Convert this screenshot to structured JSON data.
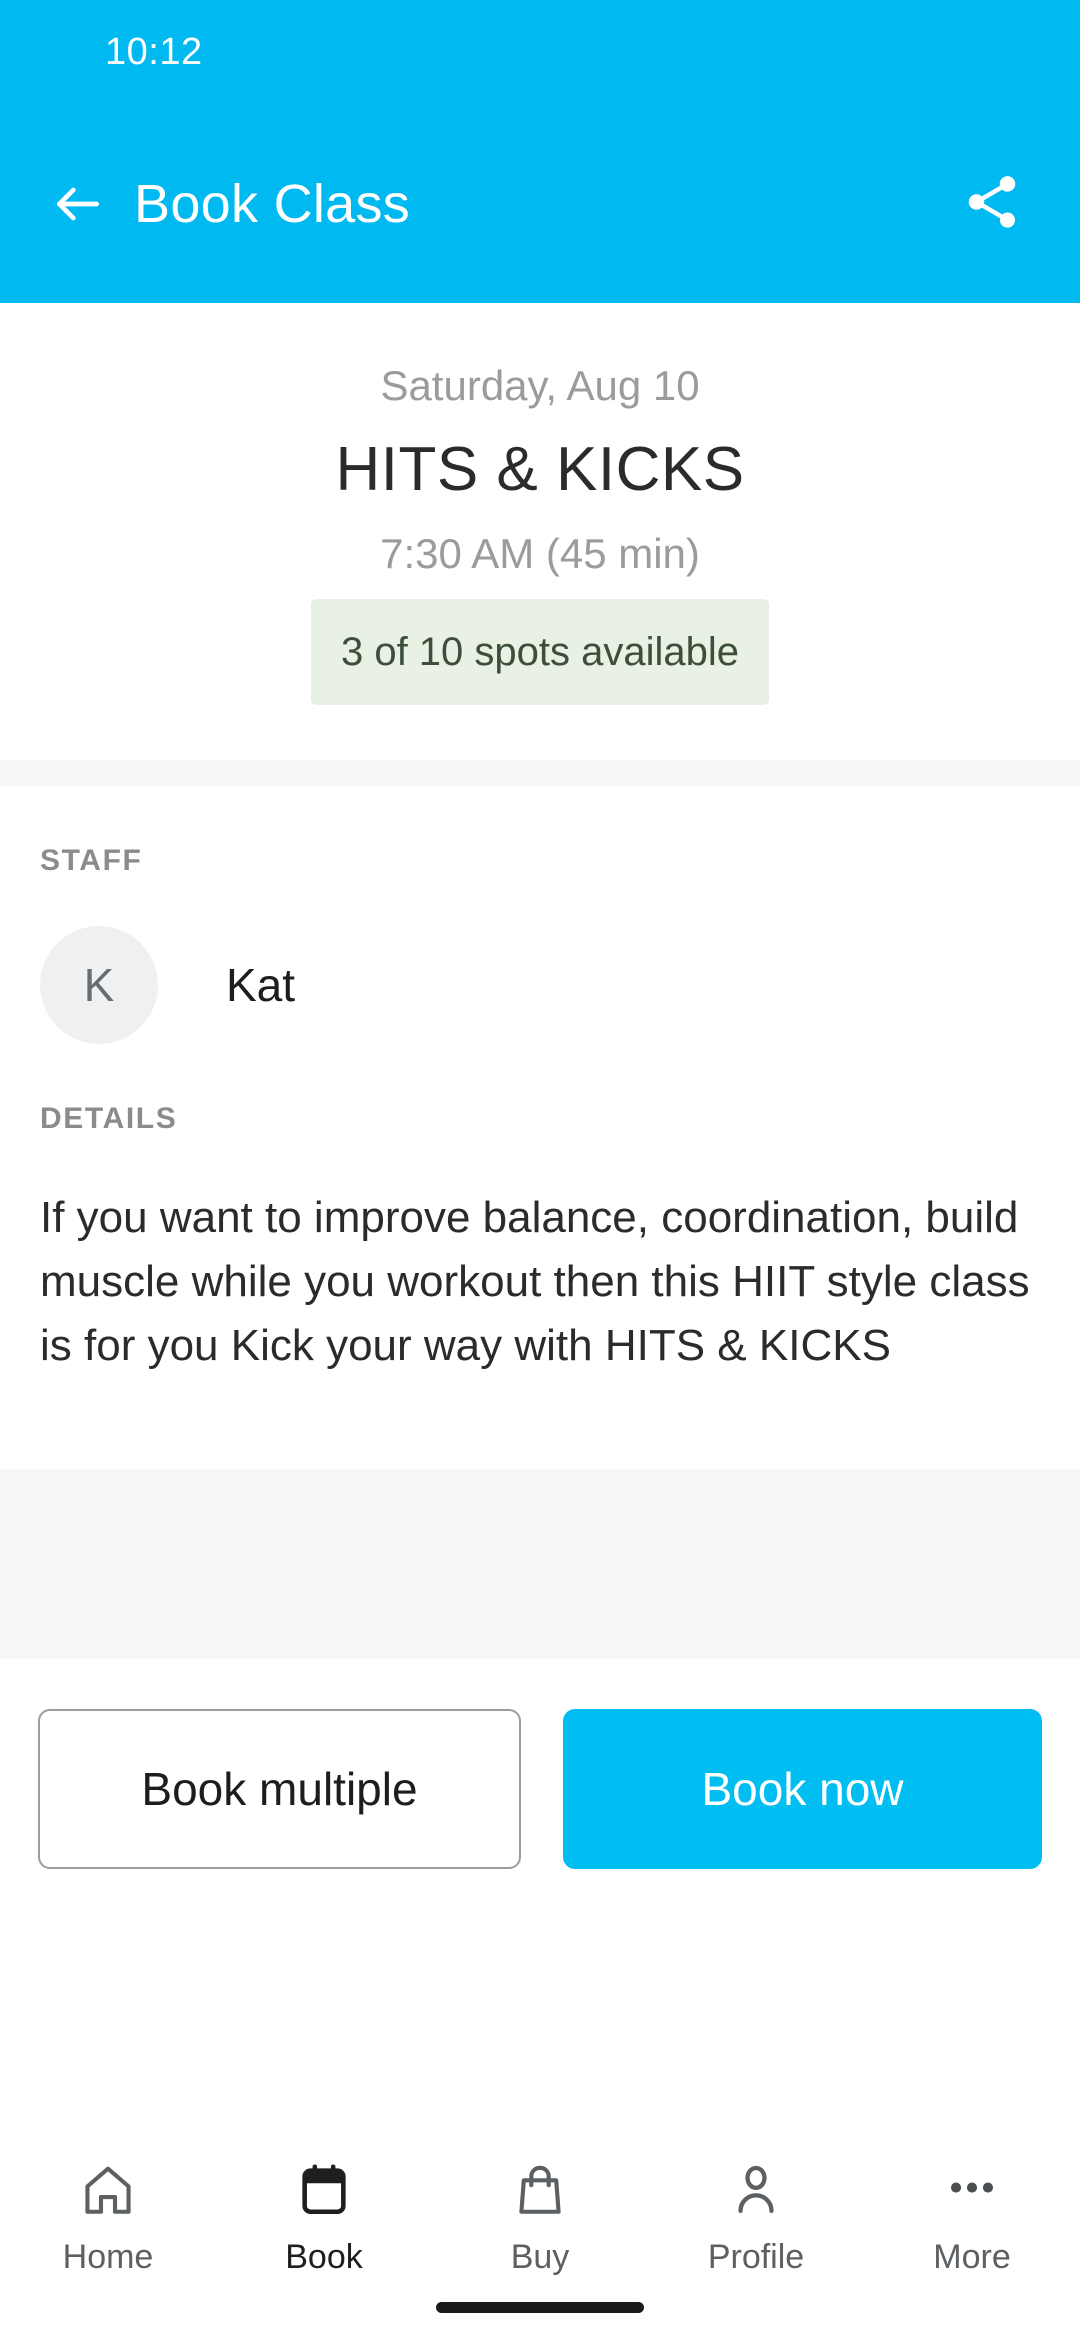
{
  "status_bar": {
    "time": "10:12"
  },
  "app_bar": {
    "title": "Book Class",
    "back_icon": "arrow-left-icon",
    "share_icon": "share-icon",
    "background_color": "#00b9f1"
  },
  "hero": {
    "date": "Saturday, Aug 10",
    "class_name": "HITS & KICKS",
    "time_and_duration": "7:30 AM (45 min)",
    "availability_badge": "3 of 10 spots available",
    "availability_badge_bg": "#e8f1e3",
    "availability_badge_text_color": "#3d4f3b"
  },
  "staff": {
    "section_label": "STAFF",
    "members": [
      {
        "initial": "K",
        "name": "Kat"
      }
    ]
  },
  "details": {
    "section_label": "DETAILS",
    "text": "If you want to improve balance, coordination, build muscle while you workout then this HIIT style class is for you Kick your way with HITS & KICKS"
  },
  "actions": {
    "secondary_label": "Book multiple",
    "primary_label": "Book now",
    "primary_color": "#00bdf2"
  },
  "bottom_nav": {
    "items": [
      {
        "label": "Home",
        "icon": "home-icon",
        "active": false
      },
      {
        "label": "Book",
        "icon": "calendar-icon",
        "active": true
      },
      {
        "label": "Buy",
        "icon": "bag-icon",
        "active": false
      },
      {
        "label": "Profile",
        "icon": "person-icon",
        "active": false
      },
      {
        "label": "More",
        "icon": "ellipsis-icon",
        "active": false
      }
    ]
  }
}
